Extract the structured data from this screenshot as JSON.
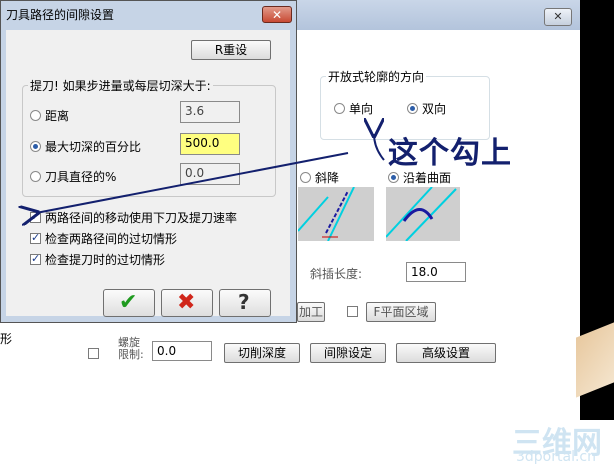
{
  "background": {
    "close_label": "✕",
    "open_contour": {
      "title": "开放式轮廓的方向",
      "options": [
        {
          "label": "单向",
          "checked": false
        },
        {
          "label": "双向",
          "checked": true
        }
      ]
    },
    "approach": {
      "options": [
        {
          "label": "斜降",
          "checked": false
        },
        {
          "label": "沿着曲面",
          "checked": true
        }
      ]
    },
    "insert_length": {
      "label": "斜插长度:",
      "value": "18.0"
    },
    "machine_button": "加工",
    "flat_region": {
      "label": "F平面区域",
      "checked": false
    },
    "left_stub": "形",
    "spiral": {
      "label_line1": "螺旋",
      "label_line2": "限制:",
      "value": "0.0",
      "checked": false
    },
    "buttons": {
      "cut_depth": "切削深度",
      "gap_settings": "间隙设定",
      "advanced": "高级设置"
    }
  },
  "dialog": {
    "title": "刀具路径的间隙设置",
    "close_label": "✕",
    "reset_button": "R重设",
    "retract_group_title": "提刀! 如果步进量或每层切深大于:",
    "options": [
      {
        "label": "距离",
        "value": "3.6",
        "checked": false
      },
      {
        "label": "最大切深的百分比",
        "value": "500.0",
        "checked": true
      },
      {
        "label": "刀具直径的%",
        "value": "0.0",
        "checked": false
      }
    ],
    "checkboxes": [
      {
        "label": "两路径间的移动使用下刀及提刀速率",
        "checked": true
      },
      {
        "label": "检查两路径间的过切情形",
        "checked": true
      },
      {
        "label": "检查提刀时的过切情形",
        "checked": true
      }
    ],
    "ok_icon": "check-icon",
    "cancel_icon": "x-icon",
    "help_icon": "question-icon",
    "ok_symbol": "✔",
    "cancel_symbol": "✖",
    "help_symbol": "?"
  },
  "annotation": {
    "text": "这个勾上",
    "color": "#13206e"
  },
  "watermark": {
    "logo": "三维网",
    "url": "3dportal.cn"
  }
}
